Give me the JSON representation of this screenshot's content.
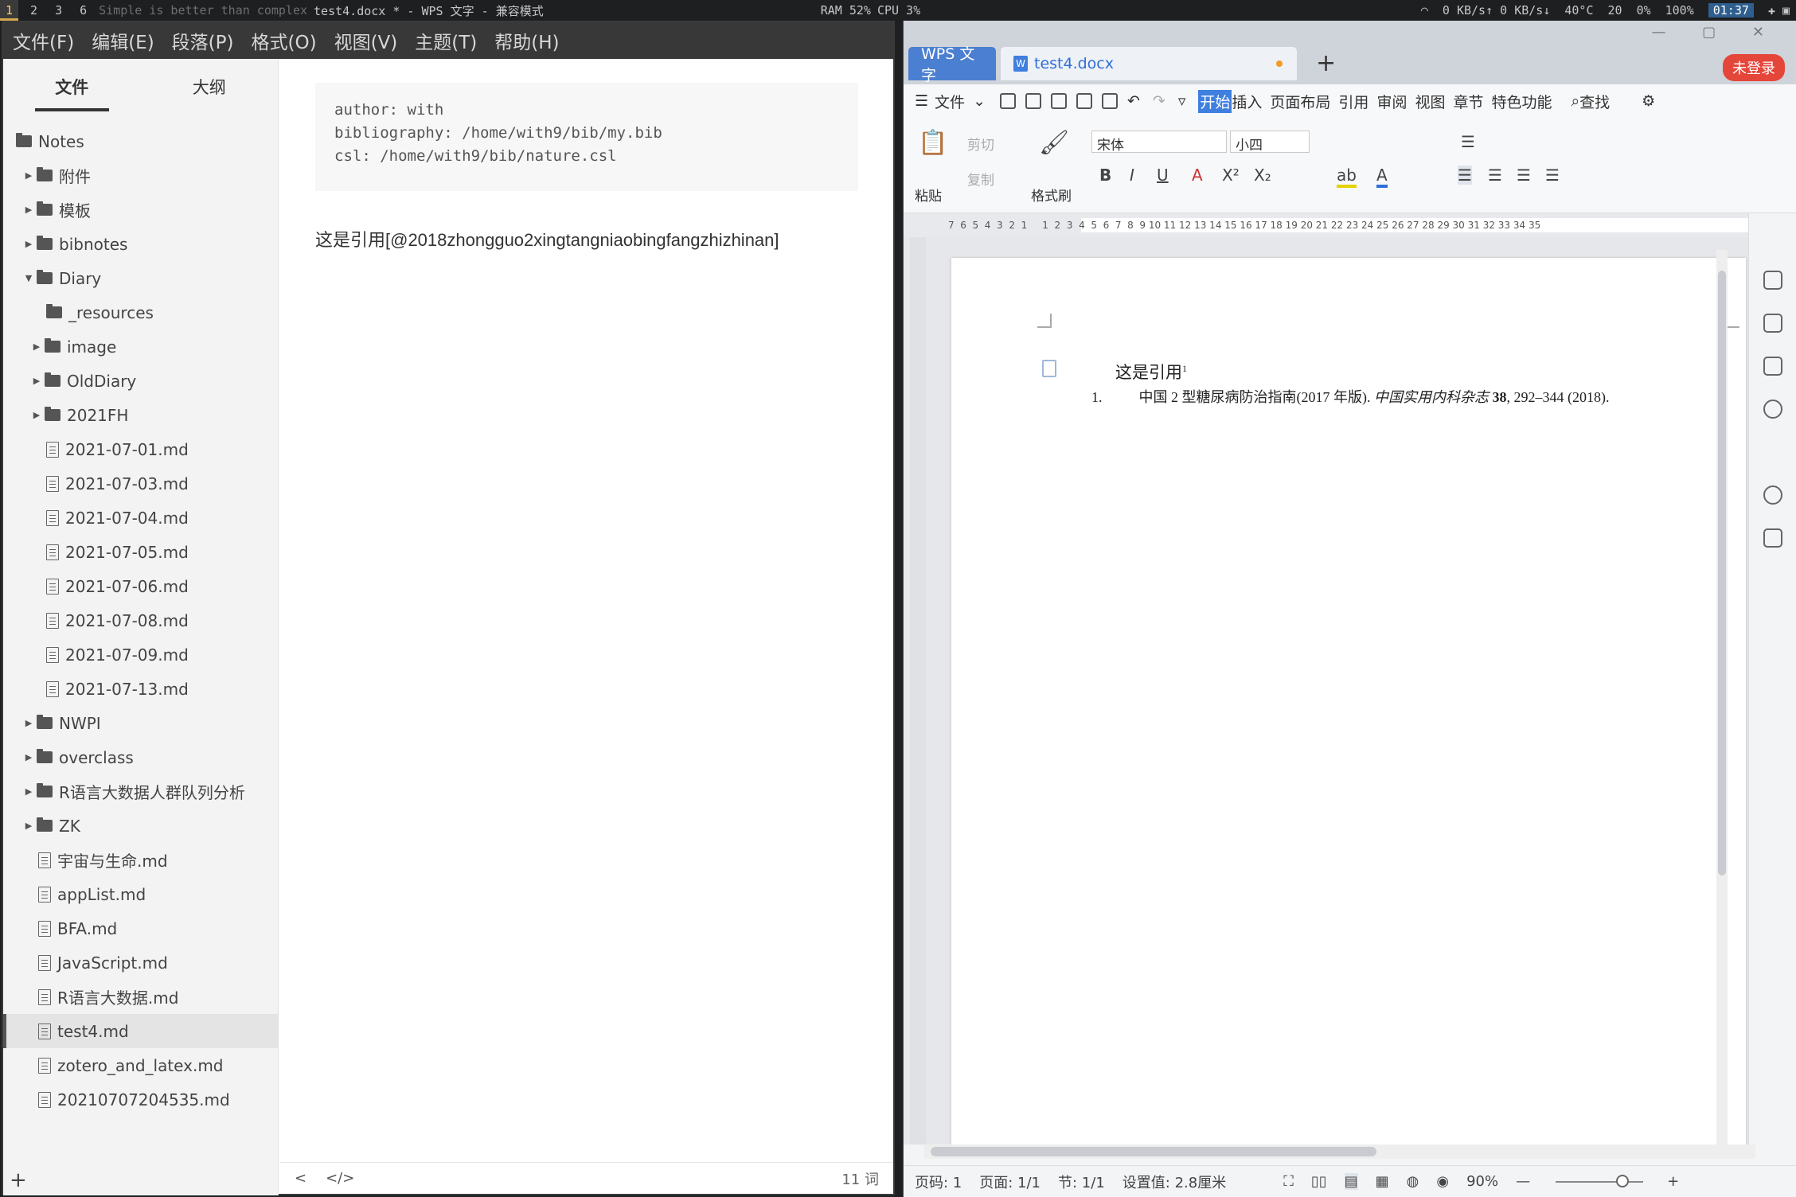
{
  "bar": {
    "workspaces": [
      "1",
      "2",
      "3",
      "6"
    ],
    "motto": "Simple is better than complex",
    "title": "test4.docx * - WPS 文字 - 兼容模式",
    "ram": "RAM 52%",
    "cpu": "CPU 3%",
    "net": "0 KB/s↑ 0 KB/s↓",
    "temp": "40°C",
    "bright": "20",
    "vol": "0%",
    "bat": "100%",
    "clock": "01:37"
  },
  "typora": {
    "menu": [
      "文件(F)",
      "编辑(E)",
      "段落(P)",
      "格式(O)",
      "视图(V)",
      "主题(T)",
      "帮助(H)"
    ],
    "tabs": [
      "文件",
      "大纲"
    ],
    "tree": [
      {
        "label": "Notes",
        "type": "folder",
        "level": 0,
        "caret": ""
      },
      {
        "label": "附件",
        "type": "folder",
        "level": 1,
        "caret": "▶"
      },
      {
        "label": "模板",
        "type": "folder",
        "level": 1,
        "caret": "▶"
      },
      {
        "label": "bibnotes",
        "type": "folder",
        "level": 1,
        "caret": "▶"
      },
      {
        "label": "Diary",
        "type": "folder",
        "level": 1,
        "caret": "▼"
      },
      {
        "label": "_resources",
        "type": "folder",
        "level": 2,
        "caret": ""
      },
      {
        "label": "image",
        "type": "folder",
        "level": 2,
        "caret": "▶"
      },
      {
        "label": "OldDiary",
        "type": "folder",
        "level": 2,
        "caret": "▶"
      },
      {
        "label": "2021FH",
        "type": "folder",
        "level": 2,
        "caret": "▶"
      },
      {
        "label": "2021-07-01.md",
        "type": "file",
        "level": 2,
        "caret": ""
      },
      {
        "label": "2021-07-03.md",
        "type": "file",
        "level": 2,
        "caret": ""
      },
      {
        "label": "2021-07-04.md",
        "type": "file",
        "level": 2,
        "caret": ""
      },
      {
        "label": "2021-07-05.md",
        "type": "file",
        "level": 2,
        "caret": ""
      },
      {
        "label": "2021-07-06.md",
        "type": "file",
        "level": 2,
        "caret": ""
      },
      {
        "label": "2021-07-08.md",
        "type": "file",
        "level": 2,
        "caret": ""
      },
      {
        "label": "2021-07-09.md",
        "type": "file",
        "level": 2,
        "caret": ""
      },
      {
        "label": "2021-07-13.md",
        "type": "file",
        "level": 2,
        "caret": ""
      },
      {
        "label": "NWPI",
        "type": "folder",
        "level": 1,
        "caret": "▶"
      },
      {
        "label": "overclass",
        "type": "folder",
        "level": 1,
        "caret": "▶"
      },
      {
        "label": "R语言大数据人群队列分析",
        "type": "folder",
        "level": 1,
        "caret": "▶"
      },
      {
        "label": "ZK",
        "type": "folder",
        "level": 1,
        "caret": "▶"
      },
      {
        "label": "宇宙与生命.md",
        "type": "file",
        "level": 1,
        "caret": ""
      },
      {
        "label": "appList.md",
        "type": "file",
        "level": 1,
        "caret": ""
      },
      {
        "label": "BFA.md",
        "type": "file",
        "level": 1,
        "caret": ""
      },
      {
        "label": "JavaScript.md",
        "type": "file",
        "level": 1,
        "caret": ""
      },
      {
        "label": "R语言大数据.md",
        "type": "file",
        "level": 1,
        "caret": ""
      },
      {
        "label": "test4.md",
        "type": "file",
        "level": 1,
        "caret": "",
        "selected": true
      },
      {
        "label": "zotero_and_latex.md",
        "type": "file",
        "level": 1,
        "caret": ""
      },
      {
        "label": "20210707204535.md",
        "type": "file",
        "level": 1,
        "caret": ""
      }
    ],
    "front": [
      "author: with",
      "bibliography: /home/with9/bib/my.bib",
      "csl: /home/with9/bib/nature.csl"
    ],
    "body": "这是引用[@2018zhongguo2xingtangniaobingfangzhizhinan]",
    "wordcount": "11 词",
    "add": "+",
    "back": "<",
    "code": "</>"
  },
  "wps": {
    "app_tab": "WPS 文字",
    "doc_tab": "test4.docx",
    "login": "未登录",
    "menu": [
      "文件",
      "开始",
      "插入",
      "页面布局",
      "引用",
      "审阅",
      "视图",
      "章节",
      "特色功能",
      "查找"
    ],
    "ribbon": {
      "paste": "粘贴",
      "cut": "剪切",
      "copy": "复制",
      "painter": "格式刷",
      "font": "宋体",
      "size": "小四"
    },
    "doc": {
      "text": "这是引用",
      "sup": "1",
      "ref_num": "1.",
      "ref_a": "中国 2 型糖尿病防治指南(2017 年版). ",
      "ref_journal": "中国实用内科杂志",
      "ref_vol": " 38",
      "ref_b": ", 292–344 (2018)."
    },
    "status": {
      "page": "页码: 1",
      "pages": "页面: 1/1",
      "section": "节: 1/1",
      "setting": "设置值: 2.8厘米",
      "zoom": "90%"
    }
  }
}
